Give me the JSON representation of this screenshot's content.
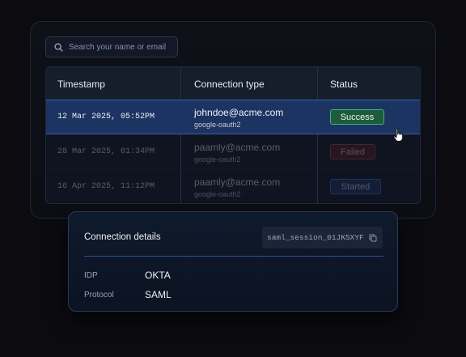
{
  "search": {
    "placeholder": "Search your name or email"
  },
  "table": {
    "headers": {
      "timestamp": "Timestamp",
      "connection_type": "Connection type",
      "status": "Status"
    },
    "rows": [
      {
        "timestamp": "12 Mar 2025, 05:52PM",
        "email": "johndoe@acme.com",
        "provider": "google-oauth2",
        "status": "Success"
      },
      {
        "timestamp": "28 Mar 2025, 01:34PM",
        "email": "paamly@acme.com",
        "provider": "google-oauth2",
        "status": "Failed"
      },
      {
        "timestamp": "16 Apr 2025, 11:12PM",
        "email": "paamly@acme.com",
        "provider": "google-oauth2",
        "status": "Started"
      }
    ]
  },
  "details": {
    "title": "Connection details",
    "session_id": "saml_session_01JKSXYF",
    "fields": [
      {
        "key": "IDP",
        "value": "OKTA"
      },
      {
        "key": "Protocol",
        "value": "SAML"
      }
    ]
  },
  "colors": {
    "success": "#1e5a3c",
    "failed": "#5b1d22",
    "started": "#173563",
    "selected_row": "#1c3461"
  },
  "icons": [
    "search-icon",
    "copy-icon",
    "pointer-cursor-icon"
  ]
}
